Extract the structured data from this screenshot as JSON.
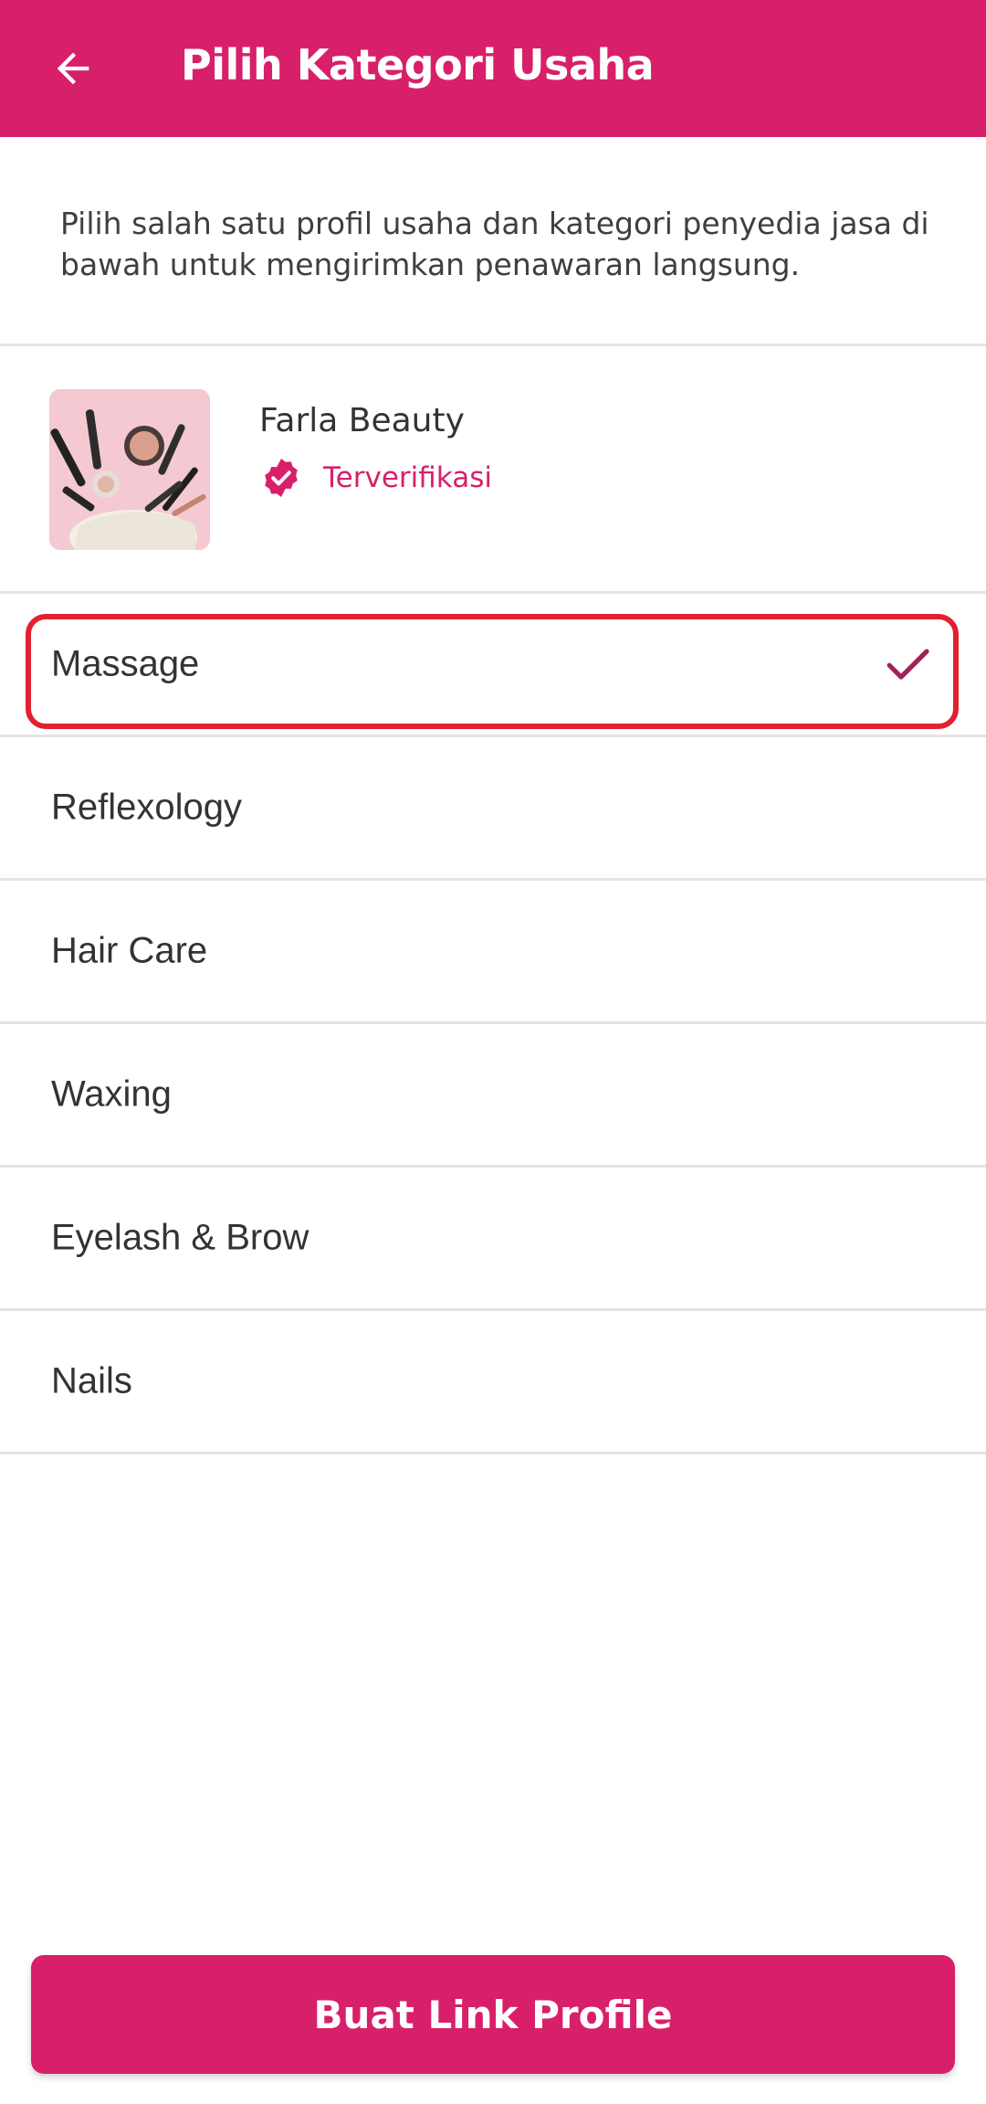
{
  "header": {
    "title": "Pilih Kategori Usaha",
    "back_icon": "arrow-left-icon",
    "background": "#D81F6A"
  },
  "intro": {
    "text": "Pilih salah satu profil usaha dan kategori penyedia jasa di bawah untuk mengirimkan penawaran langsung."
  },
  "business": {
    "name": "Farla Beauty",
    "status": "Terverifikasi",
    "status_icon": "verified-badge-icon",
    "thumbnail_icon": "cosmetics-thumbnail"
  },
  "categories": [
    {
      "label": "Massage",
      "selected": true
    },
    {
      "label": "Reflexology",
      "selected": false
    },
    {
      "label": "Hair Care",
      "selected": false
    },
    {
      "label": "Waxing",
      "selected": false
    },
    {
      "label": "Eyelash & Brow",
      "selected": false
    },
    {
      "label": "Nails",
      "selected": false
    }
  ],
  "cta": {
    "label": "Buat Link Profile"
  },
  "colors": {
    "accent": "#D81F6A",
    "highlight": "#E2202F",
    "divider": "#E4E4E4"
  }
}
